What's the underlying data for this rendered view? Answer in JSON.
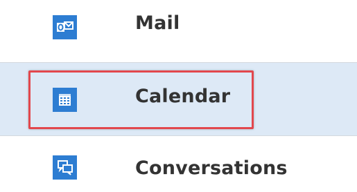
{
  "nav": {
    "items": [
      {
        "label": "Mail",
        "icon": "outlook-mail-icon",
        "selected": false
      },
      {
        "label": "Calendar",
        "icon": "calendar-grid-icon",
        "selected": true
      },
      {
        "label": "Conversations",
        "icon": "speech-bubbles-icon",
        "selected": false
      }
    ]
  },
  "colors": {
    "icon_bg": "#2d7dd2",
    "selected_row_bg": "#dde9f6",
    "highlight_border": "#e2474d",
    "label_text": "#333333"
  }
}
